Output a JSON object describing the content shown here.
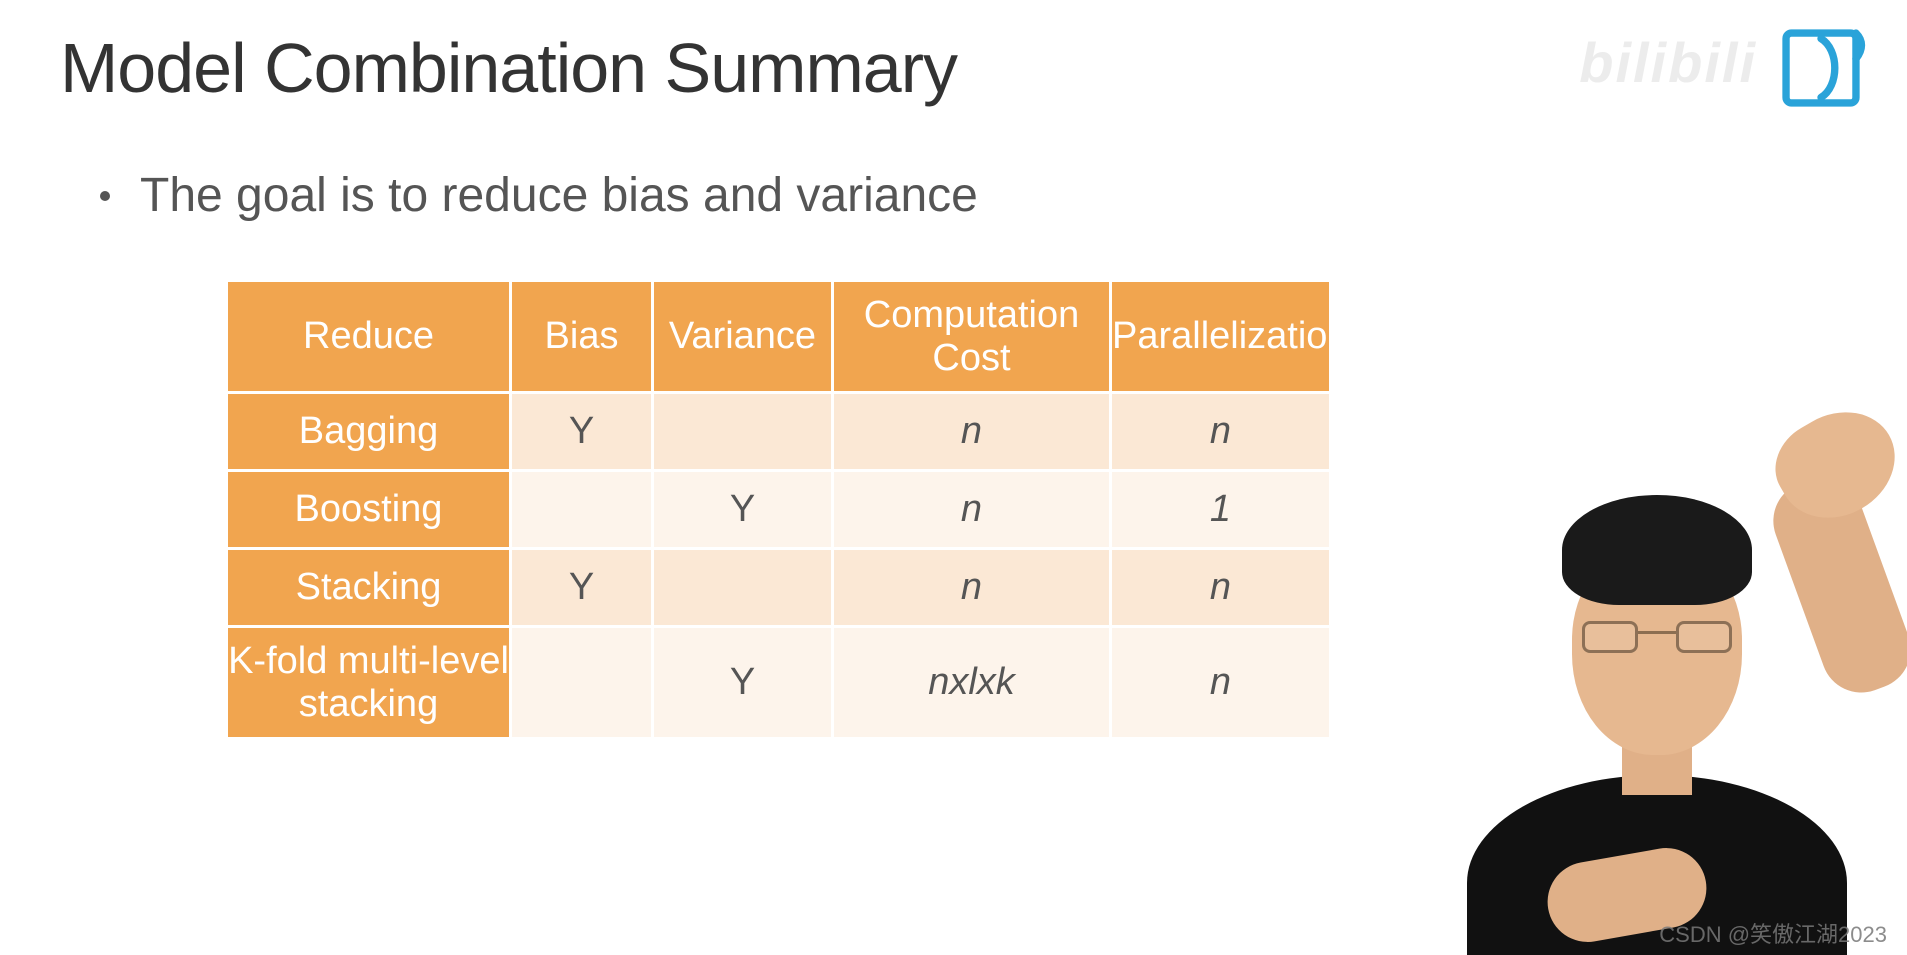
{
  "slide": {
    "title": "Model Combination Summary",
    "bullet": "The goal is to reduce bias and variance"
  },
  "table": {
    "headers": [
      "Reduce",
      "Bias",
      "Variance",
      "Computation Cost",
      "Parallelization"
    ],
    "rows": [
      {
        "label": "Bagging",
        "bias": "Y",
        "variance": "",
        "cost": "n",
        "parallel": "n"
      },
      {
        "label": "Boosting",
        "bias": "",
        "variance": "Y",
        "cost": "n",
        "parallel": "1"
      },
      {
        "label": "Stacking",
        "bias": "Y",
        "variance": "",
        "cost": "n",
        "parallel": "n"
      },
      {
        "label": "K-fold multi-level stacking",
        "bias": "",
        "variance": "Y",
        "cost": "nxlxk",
        "parallel": "n"
      }
    ]
  },
  "watermarks": {
    "top": "bilibili",
    "bottom": "CSDN @笑傲江湖2023"
  },
  "chart_data": {
    "type": "table",
    "title": "Model Combination Summary",
    "columns": [
      "Reduce",
      "Bias",
      "Variance",
      "Computation Cost",
      "Parallelization"
    ],
    "rows": [
      [
        "Bagging",
        "Y",
        "",
        "n",
        "n"
      ],
      [
        "Boosting",
        "",
        "Y",
        "n",
        "1"
      ],
      [
        "Stacking",
        "Y",
        "",
        "n",
        "n"
      ],
      [
        "K-fold multi-level stacking",
        "",
        "Y",
        "nxlxk",
        "n"
      ]
    ]
  }
}
